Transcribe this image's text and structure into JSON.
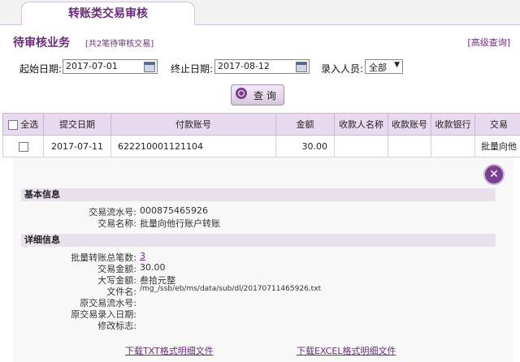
{
  "tab": {
    "title": "转账类交易审核"
  },
  "section": {
    "title": "待审核业务",
    "subtitle": "[共2笔待审核交易]",
    "advanced_link": "[高级查询]"
  },
  "filters": {
    "start_label": "起始日期:",
    "start_value": "2017-07-01",
    "end_label": "终止日期:",
    "end_value": "2017-08-12",
    "entry_label": "录入人员:",
    "entry_value": "全部"
  },
  "query_button": "查 询",
  "table": {
    "select_all": "全选",
    "headers": [
      "提交日期",
      "付款账号",
      "金额",
      "收款人名称",
      "收款账号",
      "收款银行",
      "交易"
    ],
    "rows": [
      {
        "date": "2017-07-11",
        "account": "622210001121104",
        "amount": "30.00",
        "payee_name": "",
        "payee_account": "",
        "payee_bank": "",
        "type": "批量向他"
      }
    ]
  },
  "detail": {
    "basic_title": "基本信息",
    "basic": [
      {
        "label": "交易流水号:",
        "value": "000875465926"
      },
      {
        "label": "交易名称:",
        "value": "批量向他行账户转账"
      }
    ],
    "detail_title": "详细信息",
    "details": [
      {
        "label": "批量转账总笔数:",
        "value": "3"
      },
      {
        "label": "交易金额:",
        "value": "30.00"
      },
      {
        "label": "大写金额:",
        "value": "叁拾元整"
      },
      {
        "label": "文件名:",
        "value": "/mg_/ssb/eb/ms/data/sub/dl/20170711465926.txt"
      },
      {
        "label": "原交易流水号:",
        "value": ""
      },
      {
        "label": "原交易录入日期:",
        "value": ""
      },
      {
        "label": "修改标志:",
        "value": ""
      }
    ],
    "download_txt": "下载TXT格式明细文件",
    "download_excel": "下载EXCEL格式明细文件"
  }
}
